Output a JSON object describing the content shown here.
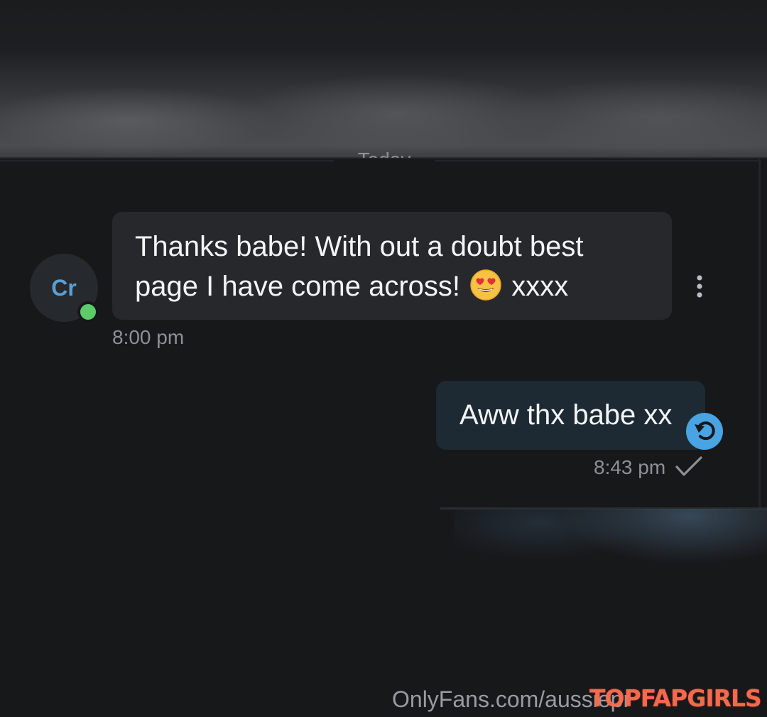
{
  "chat": {
    "date_divider": "Today",
    "incoming": {
      "avatar_initials": "Cr",
      "text_before_emoji": "Thanks babe! With out a doubt best page I have come across! ",
      "emoji_name": "heart-eyes-emoji",
      "text_after_emoji": " xxxx",
      "time": "8:00 pm"
    },
    "outgoing": {
      "text": "Aww thx babe xx",
      "time": "8:43 pm"
    }
  },
  "watermark": {
    "url": "OnlyFans.com/aussiepr",
    "logo": "TOPFAPGIRLS"
  },
  "colors": {
    "background": "#17181a",
    "incoming_bubble": "#26282b",
    "outgoing_bubble": "#1d2a33",
    "accent_blue": "#4aa3e3",
    "online_green": "#5ccb6a",
    "muted_text": "#8d9196"
  },
  "icons": {
    "menu": "more-vertical-icon",
    "reply": "undo-arrow-icon",
    "sent": "checkmark-icon"
  }
}
